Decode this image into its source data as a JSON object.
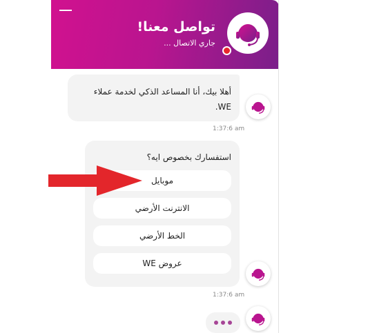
{
  "header": {
    "title": "تواصل معنا!",
    "status": "جاري الاتصال ...",
    "minimize_icon": "minimize-icon",
    "avatar_icon": "headset-agent-icon"
  },
  "messages": [
    {
      "text": "أهلا بيك، أنا المساعد الذكي لخدمة عملاء WE.",
      "time": "1:37:6 am"
    },
    {
      "question": "استفسارك بخصوص ايه؟",
      "options": [
        "موبايل",
        "الانترنت الأرضي",
        "الخط الأرضي",
        "عروض WE"
      ],
      "time": "1:37:6 am"
    }
  ],
  "colors": {
    "header_gradient_start": "#d1118f",
    "header_gradient_end": "#7a1f8a",
    "bubble_bg": "#f3f3f3",
    "arrow": "#e3262b",
    "status_dot": "#e8262c"
  }
}
